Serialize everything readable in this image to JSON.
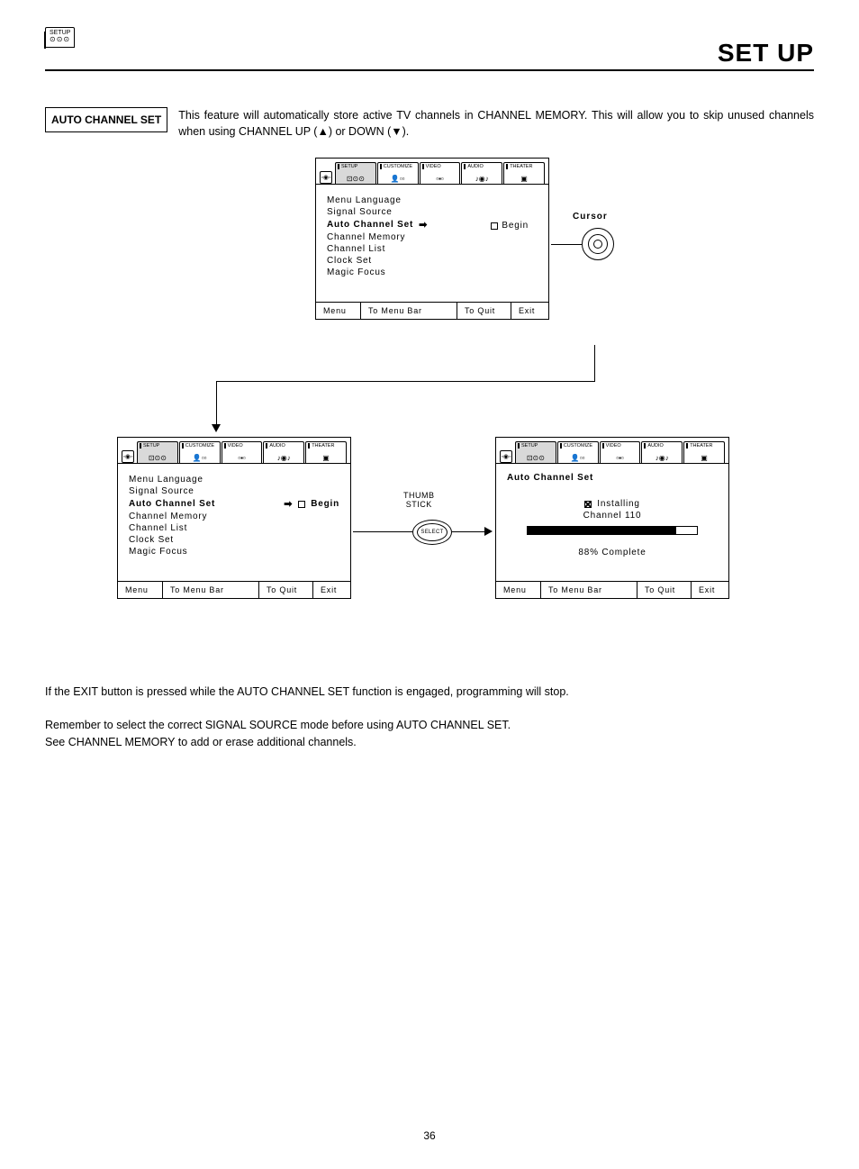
{
  "header": {
    "badge_label": "SETUP",
    "page_title": "SET UP"
  },
  "section": {
    "label": "AUTO CHANNEL SET",
    "intro": "This feature will automatically store active TV channels in CHANNEL MEMORY.  This will allow you to skip unused channels when using CHANNEL UP (▲) or DOWN (▼)."
  },
  "tabs": [
    "SETUP",
    "CUSTOMIZE",
    "VIDEO",
    "AUDIO",
    "THEATER"
  ],
  "cursor_label": "Cursor",
  "menu": {
    "items": [
      "Menu Language",
      "Signal Source",
      "Auto Channel Set",
      "Channel Memory",
      "Channel List",
      "Clock Set",
      "Magic Focus"
    ],
    "begin": "Begin"
  },
  "footer": {
    "c1": "Menu",
    "c2": "To Menu Bar",
    "c3": "To Quit",
    "c4": "Exit"
  },
  "thumbstick": {
    "l1": "THUMB",
    "l2": "STICK",
    "select": "SELECT"
  },
  "progress": {
    "title": "Auto Channel Set",
    "installing": "Installing",
    "channel": "Channel 110",
    "percent_text": "88% Complete",
    "percent": 88
  },
  "notes": {
    "p1": "If the EXIT button is pressed while the AUTO CHANNEL SET function is engaged, programming will stop.",
    "p2": "Remember to select the correct SIGNAL SOURCE mode before using AUTO CHANNEL SET.",
    "p3": "See CHANNEL MEMORY to add or erase additional channels."
  },
  "page_number": "36"
}
